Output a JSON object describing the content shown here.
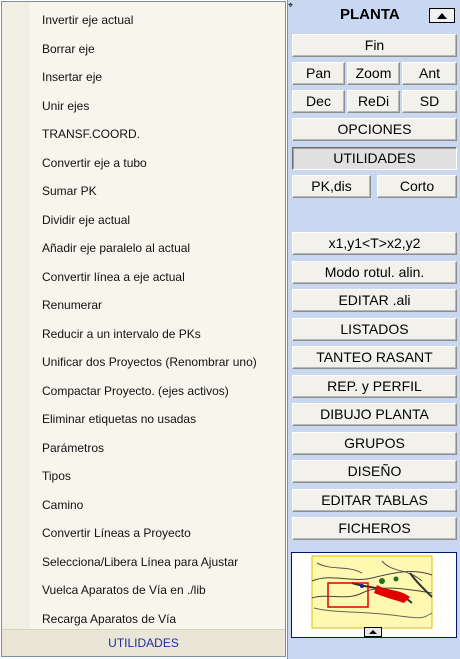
{
  "menu": {
    "items": [
      "Invertir eje actual",
      "Borrar eje",
      "Insertar eje",
      "Unir ejes",
      "TRANSF.COORD.",
      "Convertir eje a tubo",
      "Sumar PK",
      "Dividir eje actual",
      "Añadir eje paralelo al actual",
      "Convertir línea a eje actual",
      "Renumerar",
      "Reducir a un intervalo de PKs",
      "Unificar dos Proyectos (Renombrar uno)",
      "Compactar Proyecto. (ejes activos)",
      "Eliminar etiquetas no usadas",
      "Parámetros",
      "Tipos",
      "Camino",
      "Convertir Líneas a Proyecto",
      "Selecciona/Libera Línea para Ajustar",
      "Vuelca Aparatos de Vía en ./lib",
      "Recarga Aparatos de Vía"
    ],
    "footer": "UTILIDADES"
  },
  "panel": {
    "title": "PLANTA",
    "fin": "Fin",
    "pan": "Pan",
    "zoom": "Zoom",
    "ant": "Ant",
    "dec": "Dec",
    "redi": "ReDi",
    "sd": "SD",
    "opciones": "OPCIONES",
    "utilidades": "UTILIDADES",
    "pkdis": "PK,dis",
    "corto": "Corto",
    "x1y1": "x1,y1<T>x2,y2",
    "modo_rotul": "Modo rotul. alin.",
    "editar_ali": "EDITAR .ali",
    "listados": "LISTADOS",
    "tanteo": "TANTEO RASANT",
    "rep_perfil": "REP. y PERFIL",
    "dibujo_planta": "DIBUJO PLANTA",
    "grupos": "GRUPOS",
    "diseno": "DISEÑO",
    "editar_tablas": "EDITAR TABLAS",
    "ficheros": "FICHEROS"
  }
}
